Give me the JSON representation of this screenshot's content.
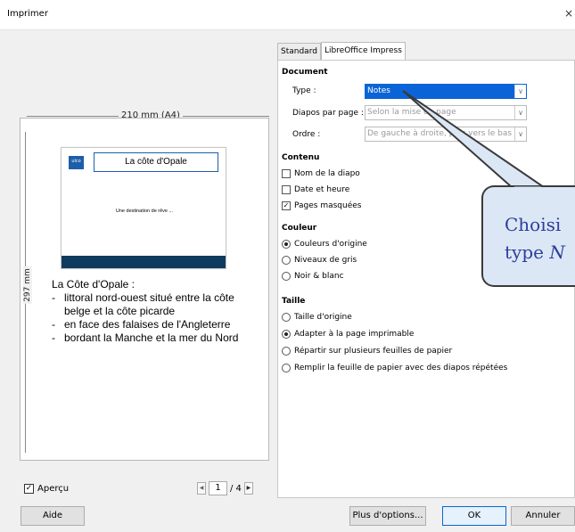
{
  "window": {
    "title": "Imprimer",
    "close": "×"
  },
  "preview": {
    "width_label": "210 mm (A4)",
    "height_label": "297 mm",
    "slide": {
      "logo": "ulco",
      "title": "La côte d'Opale",
      "subtitle": "Une destination de rêve ..."
    },
    "notes": {
      "heading": "La Côte d'Opale :",
      "bullets": [
        "littoral nord-ouest situé entre la côte belge et la côte picarde",
        "en face des falaises de l'Angleterre",
        "bordant la Manche et la mer du Nord"
      ]
    },
    "apercu_label": "Aperçu",
    "page_current": "1",
    "page_total": "/ 4"
  },
  "tabs": [
    {
      "label": "Standard"
    },
    {
      "label": "LibreOffice Impress"
    }
  ],
  "document": {
    "heading": "Document",
    "type_label": "Type :",
    "type_value": "Notes",
    "diapos_label": "Diapos par page :",
    "diapos_value": "Selon la mise en page",
    "ordre_label": "Ordre :",
    "ordre_value": "De gauche à droite, puis vers le bas"
  },
  "contenu": {
    "heading": "Contenu",
    "items": [
      {
        "label": "Nom de la diapo",
        "checked": false
      },
      {
        "label": "Date et heure",
        "checked": false
      },
      {
        "label": "Pages masquées",
        "checked": true
      }
    ]
  },
  "couleur": {
    "heading": "Couleur",
    "items": [
      {
        "label": "Couleurs d'origine",
        "selected": true
      },
      {
        "label": "Niveaux de gris",
        "selected": false
      },
      {
        "label": "Noir & blanc",
        "selected": false
      }
    ]
  },
  "taille": {
    "heading": "Taille",
    "items": [
      {
        "label": "Taille d'origine",
        "selected": false
      },
      {
        "label": "Adapter à la page imprimable",
        "selected": true
      },
      {
        "label": "Répartir sur plusieurs feuilles de papier",
        "selected": false
      },
      {
        "label": "Remplir la feuille de papier avec des diapos répétées",
        "selected": false
      }
    ]
  },
  "callout": {
    "line1": "Choisi",
    "line2a": "type ",
    "line2b": "N"
  },
  "buttons": {
    "help": "Aide",
    "more": "Plus d'options...",
    "ok": "OK",
    "cancel": "Annuler"
  }
}
